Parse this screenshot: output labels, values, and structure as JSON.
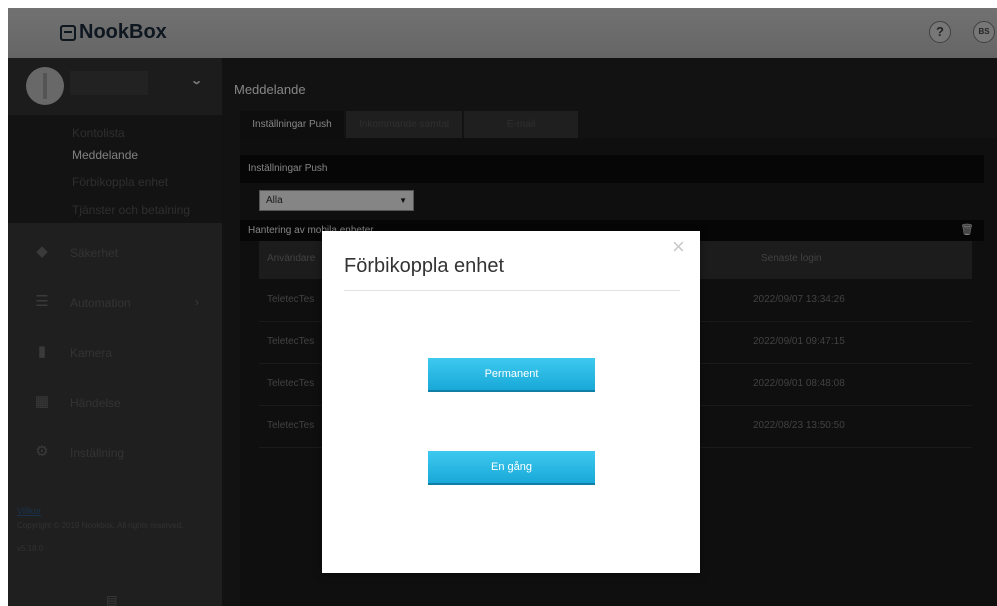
{
  "app": {
    "brand": "NookBox"
  },
  "header": {
    "help_icon": "question-mark-icon",
    "help_glyph": "?",
    "lang_badge": "BS"
  },
  "sidebar": {
    "account": {
      "name": ""
    },
    "submenu": [
      {
        "label": "Kontolista",
        "active": false
      },
      {
        "label": "Meddelande",
        "active": true
      },
      {
        "label": "Förbikoppla enhet",
        "active": false
      },
      {
        "label": "Tjänster och betalning",
        "active": false
      }
    ],
    "menu": [
      {
        "label": "Säkerhet",
        "icon": "shield-icon"
      },
      {
        "label": "Automation",
        "icon": "sliders-icon",
        "has_arrow": true
      },
      {
        "label": "Kamera",
        "icon": "camera-icon"
      },
      {
        "label": "Händelse",
        "icon": "document-icon"
      },
      {
        "label": "Inställning",
        "icon": "gear-icon"
      }
    ],
    "footer": {
      "terms": "Villkor",
      "copyright": "Copyright © 2019 Nookbox. All rights reserved.",
      "version": "v5.18.0"
    }
  },
  "main": {
    "title": "Meddelande",
    "tabs": [
      {
        "label": "Inställningar Push",
        "active": true
      },
      {
        "label": "Inkommande samtal",
        "active": false
      },
      {
        "label": "E-mail",
        "active": false
      }
    ],
    "section_title": "Inställningar Push",
    "filter": {
      "selected": "Alla"
    },
    "management_bar": "Hantering av mobila enheter",
    "table": {
      "columns": [
        "Användare",
        "Senaste login"
      ],
      "rows": [
        {
          "user": "TeletecTes",
          "last_login": "2022/09/07 13:34:26"
        },
        {
          "user": "TeletecTes",
          "last_login": "2022/09/01 09:47:15"
        },
        {
          "user": "TeletecTes",
          "last_login": "2022/09/01 08:48:08"
        },
        {
          "user": "TeletecTes",
          "last_login": "2022/08/23 13:50:50"
        }
      ]
    }
  },
  "modal": {
    "title": "Förbikoppla enhet",
    "close_glyph": "×",
    "buttons": [
      {
        "label": "Permanent"
      },
      {
        "label": "En gång"
      }
    ]
  }
}
